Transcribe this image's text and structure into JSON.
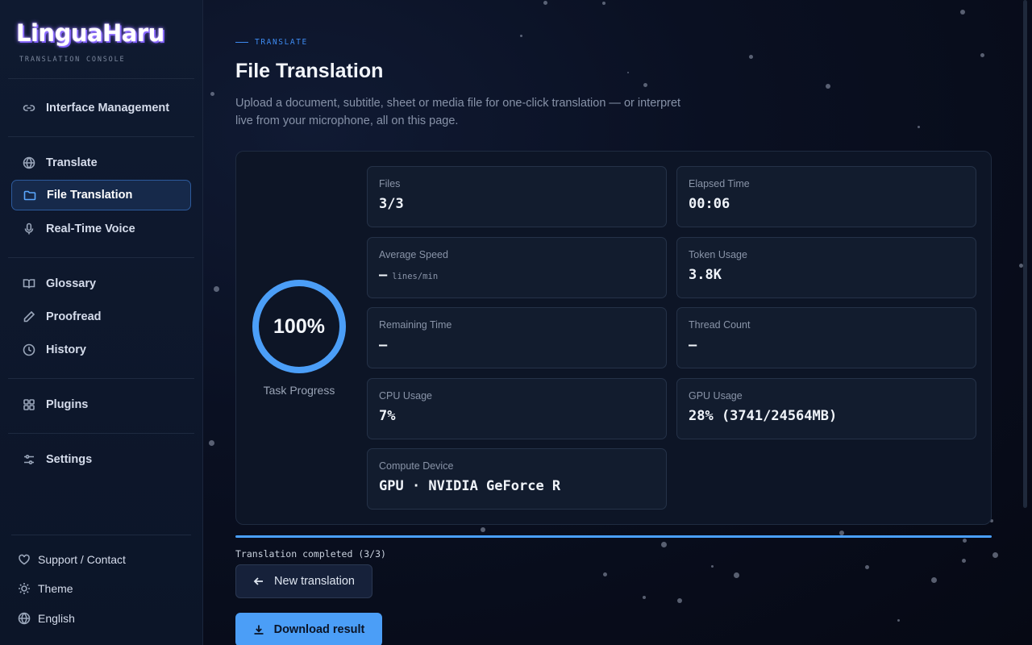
{
  "sidebar": {
    "logo": "LinguaHaru",
    "logo_subtitle": "TRANSLATION CONSOLE",
    "items": [
      {
        "label": "Interface Management",
        "icon": "link-icon"
      },
      {
        "label": "Translate",
        "icon": "globe-icon"
      },
      {
        "label": "File Translation",
        "icon": "folder-icon",
        "active": true
      },
      {
        "label": "Real-Time Voice",
        "icon": "microphone-icon"
      },
      {
        "label": "Glossary",
        "icon": "book-icon"
      },
      {
        "label": "Proofread",
        "icon": "pencil-icon"
      },
      {
        "label": "History",
        "icon": "clock-icon"
      },
      {
        "label": "Plugins",
        "icon": "grid-icon"
      },
      {
        "label": "Settings",
        "icon": "sliders-icon"
      }
    ],
    "footer": {
      "support": "Support / Contact",
      "theme": "Theme",
      "language": "English"
    }
  },
  "header": {
    "breadcrumb": "TRANSLATE",
    "title": "File Translation",
    "description": "Upload a document, subtitle, sheet or media file for one-click translation — or interpret live from your microphone, all on this page."
  },
  "progress": {
    "percent_text": "100%",
    "percent": 100,
    "label": "Task Progress"
  },
  "stats": {
    "files": {
      "label": "Files",
      "value": "3/3"
    },
    "elapsed": {
      "label": "Elapsed Time",
      "value": "00:06"
    },
    "speed": {
      "label": "Average Speed",
      "value": "—",
      "unit": "lines/min"
    },
    "tokens": {
      "label": "Token Usage",
      "value": "3.8K"
    },
    "remaining": {
      "label": "Remaining Time",
      "value": "—"
    },
    "threads": {
      "label": "Thread Count",
      "value": "—"
    },
    "cpu": {
      "label": "CPU Usage",
      "value": "7%"
    },
    "gpu": {
      "label": "GPU Usage",
      "value": "28% (3741/24564MB)"
    },
    "device": {
      "label": "Compute Device",
      "value": "GPU · NVIDIA GeForce R"
    }
  },
  "status": {
    "text": "Translation completed (3/3)",
    "bar_fill": 1.0
  },
  "actions": {
    "new_label": "New translation",
    "download_label": "Download result"
  },
  "colors": {
    "accent": "#4b9ef7",
    "background": "#070b18",
    "active_item_bg": "#16294a"
  }
}
